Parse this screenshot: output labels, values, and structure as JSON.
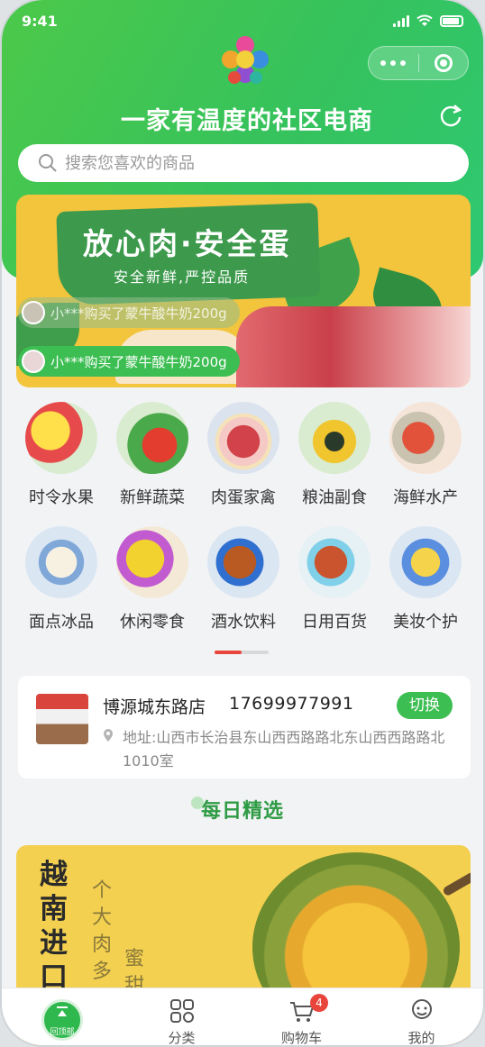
{
  "status_bar": {
    "time": "9:41"
  },
  "header": {
    "slogan": "一家有温度的社区电商",
    "search_placeholder": "搜索您喜欢的商品"
  },
  "banner": {
    "title": "放心肉·安全蛋",
    "subtitle": "安全新鲜,严控品质",
    "tickers": [
      "小***购买了蒙牛酸牛奶200g",
      "小***购买了蒙牛酸牛奶200g"
    ]
  },
  "categories": [
    {
      "label": "时令水果",
      "icon": "fruit-icon"
    },
    {
      "label": "新鲜蔬菜",
      "icon": "vegetable-icon"
    },
    {
      "label": "肉蛋家禽",
      "icon": "meat-icon"
    },
    {
      "label": "粮油副食",
      "icon": "oil-icon"
    },
    {
      "label": "海鲜水产",
      "icon": "seafood-icon"
    },
    {
      "label": "面点冰品",
      "icon": "dessert-icon"
    },
    {
      "label": "休闲零食",
      "icon": "snack-icon"
    },
    {
      "label": "酒水饮料",
      "icon": "drink-icon"
    },
    {
      "label": "日用百货",
      "icon": "household-icon"
    },
    {
      "label": "美妆个护",
      "icon": "beauty-icon"
    }
  ],
  "store": {
    "name": "博源城东路店",
    "phone": "17699977991",
    "switch_label": "切换",
    "address": "地址:山西市长治县东山西西路路北东山西西路路北1010室"
  },
  "section": {
    "title": "每日精选"
  },
  "promo": {
    "vertical_text": "越南进口菠",
    "thin_text_1": "个大肉多",
    "thin_text_2": "蜜甜"
  },
  "tabbar": {
    "home_label": "回顶部",
    "category_label": "分类",
    "cart_label": "购物车",
    "cart_badge": "4",
    "mine_label": "我的"
  },
  "colors": {
    "primary": "#3dbe52",
    "accent": "#e8453c"
  }
}
